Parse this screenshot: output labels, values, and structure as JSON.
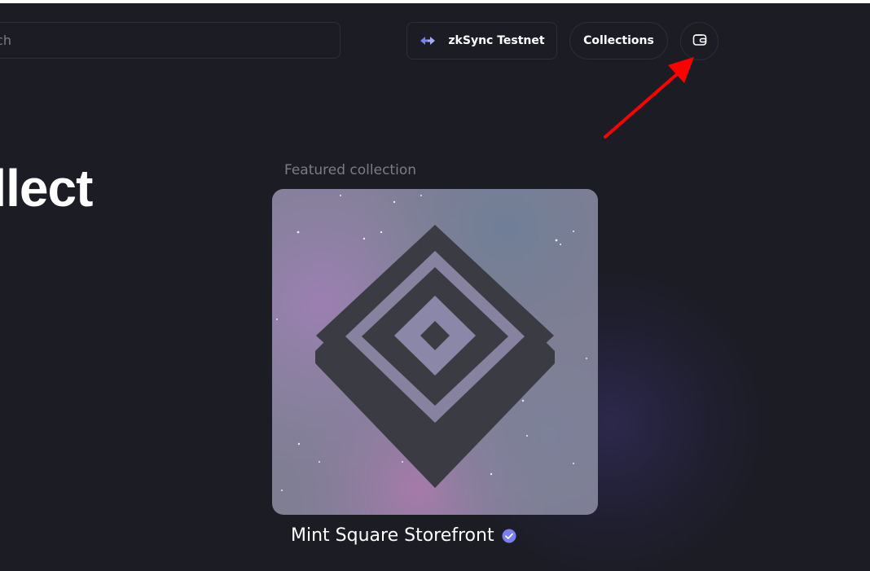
{
  "header": {
    "search_placeholder": "Search",
    "network_label": "zkSync Testnet",
    "collections_label": "Collections",
    "icons": {
      "network": "swap-arrows-icon",
      "wallet": "wallet-icon"
    }
  },
  "hero": {
    "title": "Collect"
  },
  "featured": {
    "label": "Featured collection",
    "collection_name": "Mint Square Storefront",
    "verified_icon": "verified-badge-icon"
  },
  "colors": {
    "background": "#1c1c25",
    "border": "#2e2e3a",
    "accent": "#7b7ff0",
    "annotation_arrow": "#ff0000",
    "muted_text": "#7c7c88"
  }
}
